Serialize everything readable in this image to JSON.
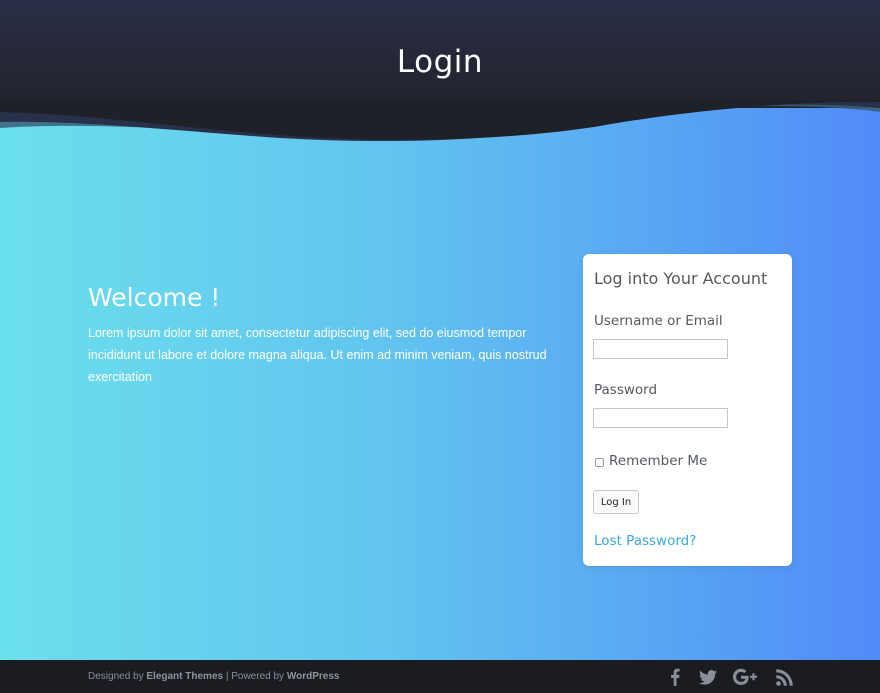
{
  "header": {
    "title": "Login"
  },
  "welcome": {
    "title": "Welcome !",
    "text": "Lorem ipsum dolor sit amet, consectetur adipiscing elit, sed do eiusmod tempor incididunt ut labore et dolore magna aliqua. Ut enim ad minim veniam, quis nostrud exercitation"
  },
  "login_card": {
    "title": "Log into Your Account",
    "username_label": "Username or Email",
    "username_value": "",
    "password_label": "Password",
    "password_value": "",
    "remember_label": "Remember Me",
    "remember_checked": false,
    "login_button": "Log In",
    "lost_password": "Lost Password?"
  },
  "footer": {
    "designed_by_prefix": "Designed by ",
    "designer": "Elegant Themes",
    "separator": " | Powered by ",
    "platform": "WordPress",
    "social_icons": [
      "facebook-icon",
      "twitter-icon",
      "google-plus-icon",
      "rss-icon"
    ]
  },
  "colors": {
    "header_bg": "#232633",
    "gradient_start": "#6ae0ec",
    "gradient_end": "#508bf8",
    "link": "#3aa8d8",
    "footer_bg": "#1b1c22"
  }
}
